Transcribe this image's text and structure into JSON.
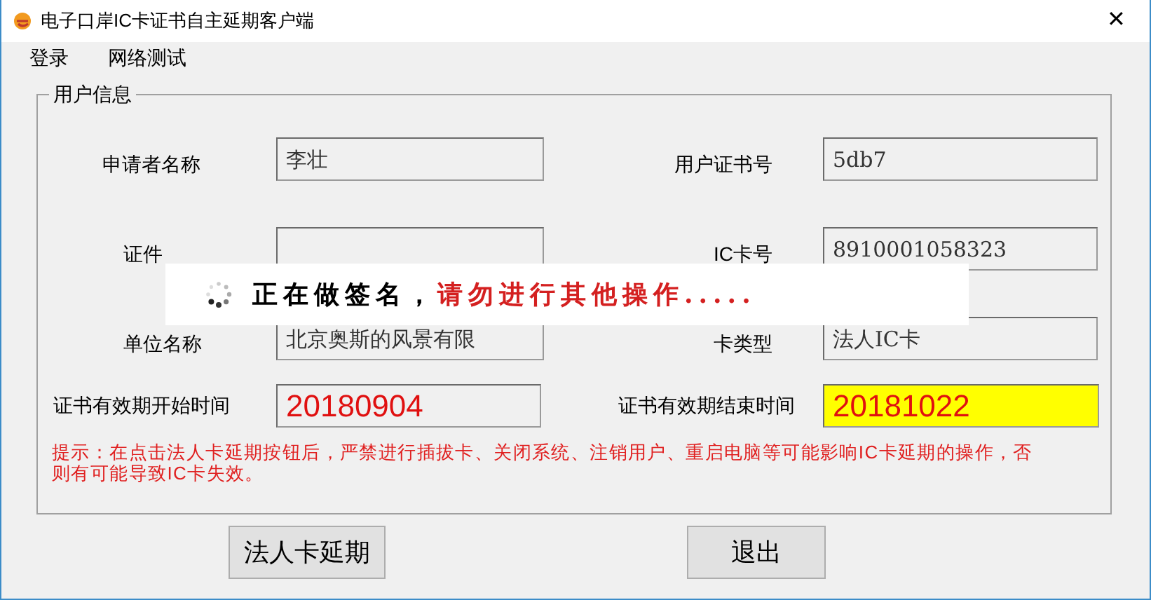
{
  "window": {
    "title": "电子口岸IC卡证书自主延期客户端",
    "close": "✕"
  },
  "menu": [
    "登录",
    "网络测试"
  ],
  "group": {
    "title": "用户信息",
    "fields": [
      {
        "label": "申请者名称",
        "value": "李壮"
      },
      {
        "label": "用户证书号",
        "value": "5db7"
      },
      {
        "label": "证件"
      },
      {
        "label": "IC卡号",
        "value": "8910001058323"
      },
      {
        "label": "单位名称",
        "value": "北京奥斯的风景有限"
      },
      {
        "label": "卡类型",
        "value": "法人IC卡"
      }
    ],
    "dates": [
      {
        "label": "证书有效期开始时间",
        "value": "20180904",
        "highlighted": false
      },
      {
        "label": "证书有效期结束时间",
        "value": "20181022",
        "highlighted": true
      }
    ],
    "hint": "提示：在点击法人卡延期按钮后，严禁进行插拔卡、关闭系统、注销用户、重启电脑等可能影响IC卡延期的操作，否则有可能导致IC卡失效。"
  },
  "buttons": [
    "法人卡延期",
    "退出"
  ],
  "overlay": {
    "status": "正在做签名，",
    "warning": "请勿进行其他操作....."
  }
}
